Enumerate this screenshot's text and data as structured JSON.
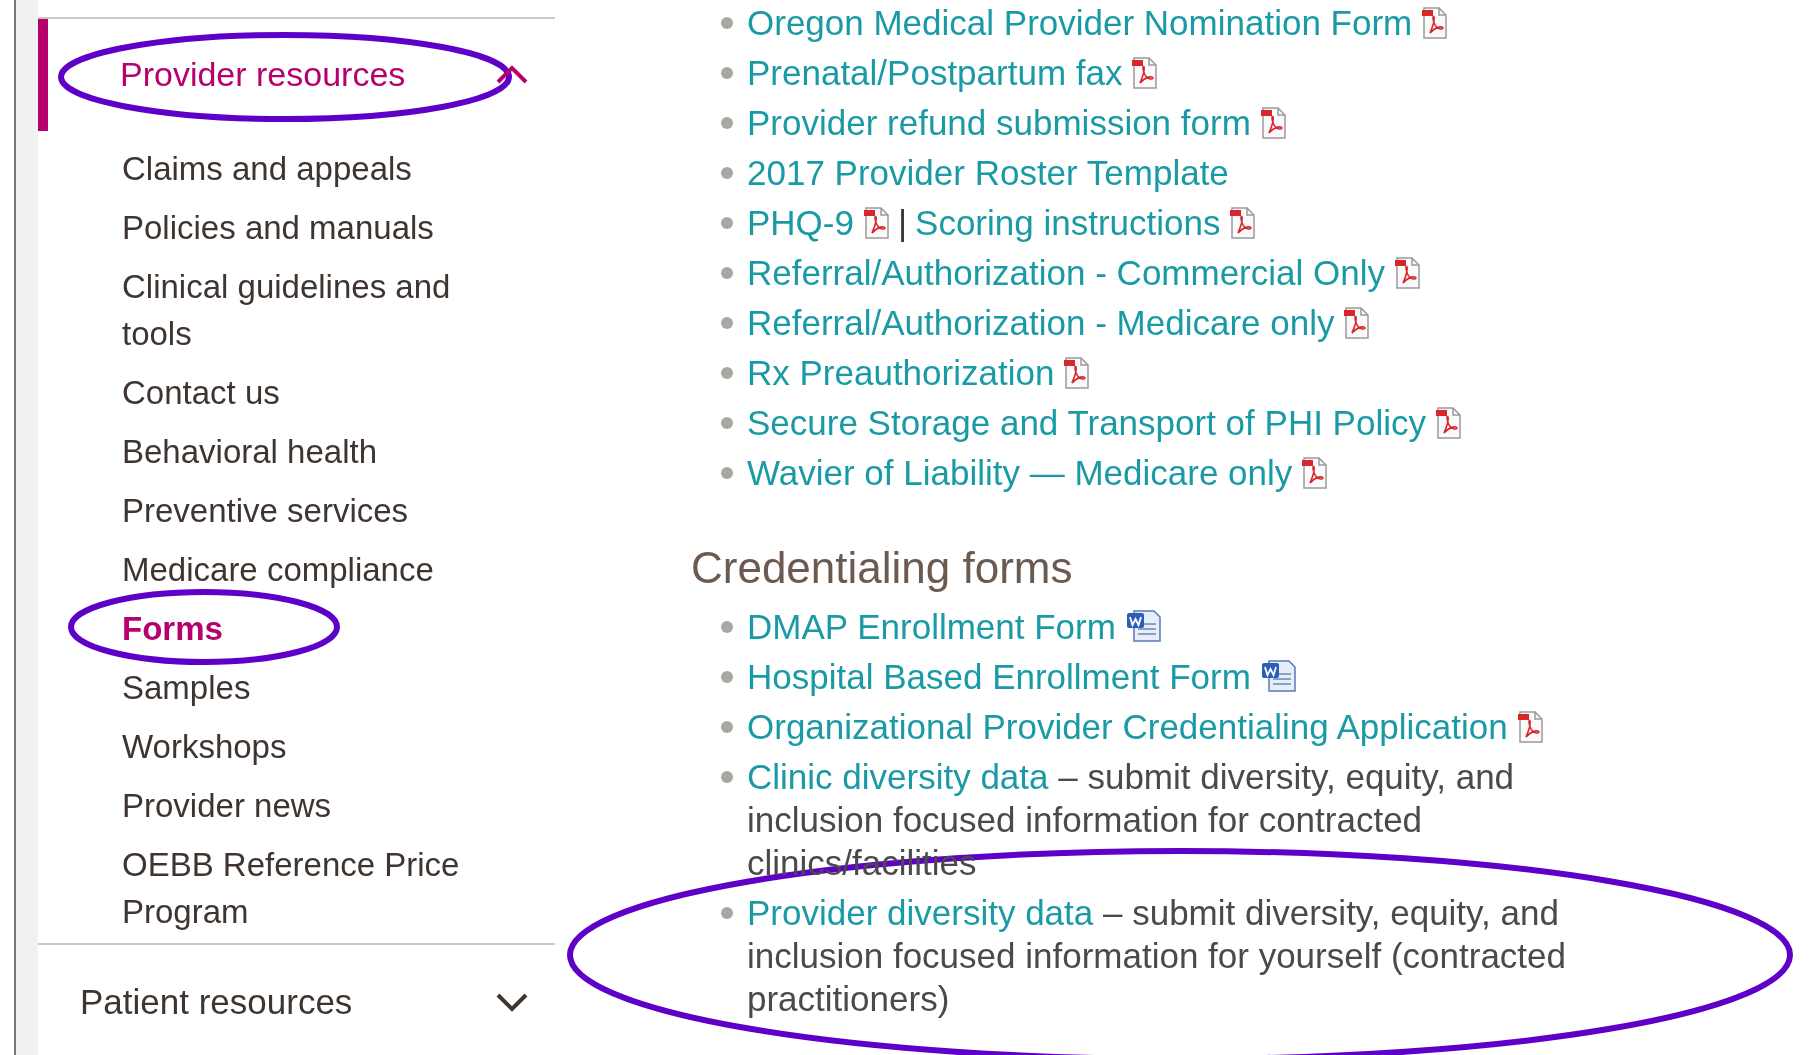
{
  "sidebar": {
    "sections": [
      {
        "label": "Provider resources",
        "expanded": true,
        "selected": true,
        "items": [
          {
            "label": "Claims and appeals",
            "selected": false
          },
          {
            "label": "Policies and manuals",
            "selected": false
          },
          {
            "label": "Clinical guidelines and tools",
            "selected": false
          },
          {
            "label": "Contact us",
            "selected": false
          },
          {
            "label": "Behavioral health",
            "selected": false
          },
          {
            "label": "Preventive services",
            "selected": false
          },
          {
            "label": "Medicare compliance",
            "selected": false
          },
          {
            "label": "Forms",
            "selected": true
          },
          {
            "label": "Samples",
            "selected": false
          },
          {
            "label": "Workshops",
            "selected": false
          },
          {
            "label": "Provider news",
            "selected": false
          },
          {
            "label": "OEBB Reference Price Program",
            "selected": false
          }
        ]
      },
      {
        "label": "Patient resources",
        "expanded": false,
        "selected": false
      }
    ]
  },
  "content": {
    "groups": [
      {
        "items": [
          {
            "links": [
              {
                "text": "Oregon Medical Provider Nomination Form",
                "kind": "pdf"
              }
            ]
          },
          {
            "links": [
              {
                "text": "Prenatal/Postpartum fax",
                "kind": "pdf"
              }
            ]
          },
          {
            "links": [
              {
                "text": "Provider refund submission form",
                "kind": "pdf"
              }
            ]
          },
          {
            "links": [
              {
                "text": "2017 Provider Roster Template",
                "kind": "plain"
              }
            ]
          },
          {
            "links": [
              {
                "text": "PHQ-9",
                "kind": "pdf"
              },
              {
                "text": "Scoring instructions",
                "kind": "pdf"
              }
            ],
            "separator": "|"
          },
          {
            "links": [
              {
                "text": "Referral/Authorization - Commercial Only",
                "kind": "pdf"
              }
            ]
          },
          {
            "links": [
              {
                "text": "Referral/Authorization - Medicare only",
                "kind": "pdf"
              }
            ]
          },
          {
            "links": [
              {
                "text": "Rx Preauthorization",
                "kind": "pdf"
              }
            ]
          },
          {
            "links": [
              {
                "text": "Secure Storage and Transport of PHI Policy",
                "kind": "pdf"
              }
            ]
          },
          {
            "links": [
              {
                "text": "Wavier of Liability — Medicare only",
                "kind": "pdf"
              }
            ]
          }
        ]
      },
      {
        "heading": "Credentialing forms",
        "items": [
          {
            "links": [
              {
                "text": "DMAP Enrollment Form",
                "kind": "word"
              }
            ]
          },
          {
            "links": [
              {
                "text": "Hospital Based Enrollment Form",
                "kind": "word"
              }
            ]
          },
          {
            "links": [
              {
                "text": "Organizational Provider Credentialing Application",
                "kind": "pdf"
              }
            ]
          },
          {
            "links": [
              {
                "text": "Clinic diversity data"
              }
            ],
            "description": "– submit diversity, equity, and inclusion focused information for contracted clinics/facilities"
          },
          {
            "links": [
              {
                "text": "Provider diversity data"
              }
            ],
            "description": "– submit diversity, equity, and inclusion focused information for yourself (contracted practitioners)"
          }
        ]
      }
    ]
  }
}
